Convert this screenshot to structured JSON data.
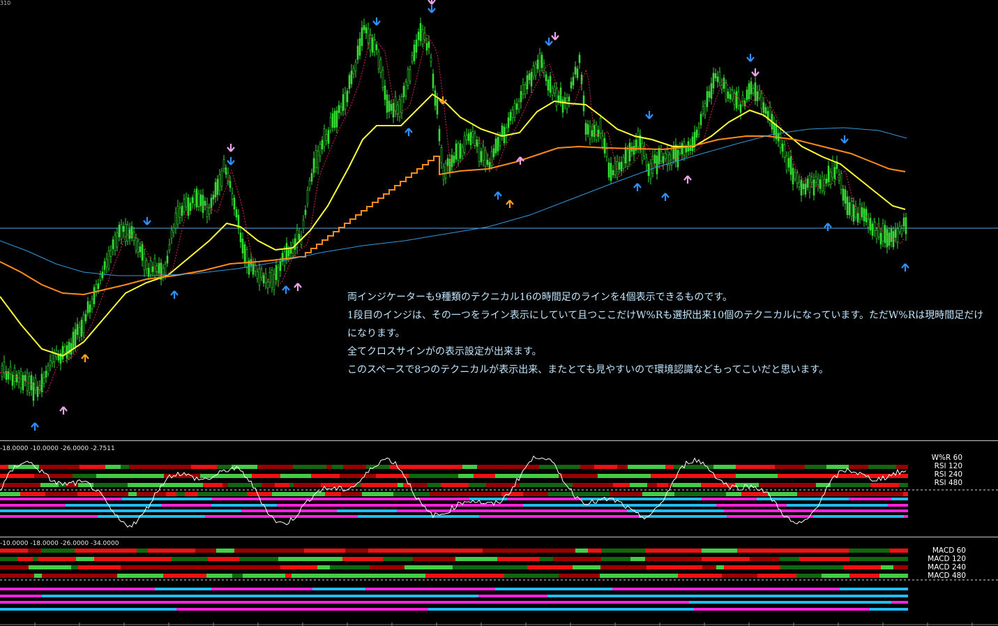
{
  "chart": {
    "corner_label": "310",
    "annotation_lines": [
      "両インジケーターも9種類のテクニカル16の時間足のラインを4個表示できるものです。",
      "1段目のインジは、その一つをライン表示にしていて且つここだけW%Rも選択出来10個のテクニカルになっています。ただW%Rは現時間足だけになります。",
      "全てクロスサインがの表示設定が出来ます。",
      "このスペースで8つのテクニカルが表示出来、またとても見やすいので環境認識などもってこいだと思います。"
    ]
  },
  "indicator1": {
    "levels_label": "-18.0000 -10.0000 -26.0000 -2.7511",
    "legend": [
      "W%R  60",
      "RSI  120",
      "RSI  240",
      "RSI  480"
    ]
  },
  "indicator2": {
    "levels_label": "-10.0000 -18.0000 -26.0000 -34.0000",
    "legend": [
      "MACD  60",
      "MACD  120",
      "MACD  240",
      "MACD  480"
    ]
  },
  "colors": {
    "candle": "#33dd33",
    "ma_yellow": "#ffff33",
    "ma_orange": "#ff8c1a",
    "ma_blue": "#3399dd",
    "dotted_red": "#dd2255",
    "hline": "#5aa9e6",
    "arrow_blue": "#2e8fff",
    "arrow_pink": "#e9a5e5",
    "arrow_orange": "#ffa020",
    "bar_red": "#ee1111",
    "bar_dark_red": "#990000",
    "bar_green": "#44cc44",
    "bar_dark_green": "#116611",
    "bar_magenta": "#ff22dd",
    "bar_cyan": "#22bbee"
  }
}
